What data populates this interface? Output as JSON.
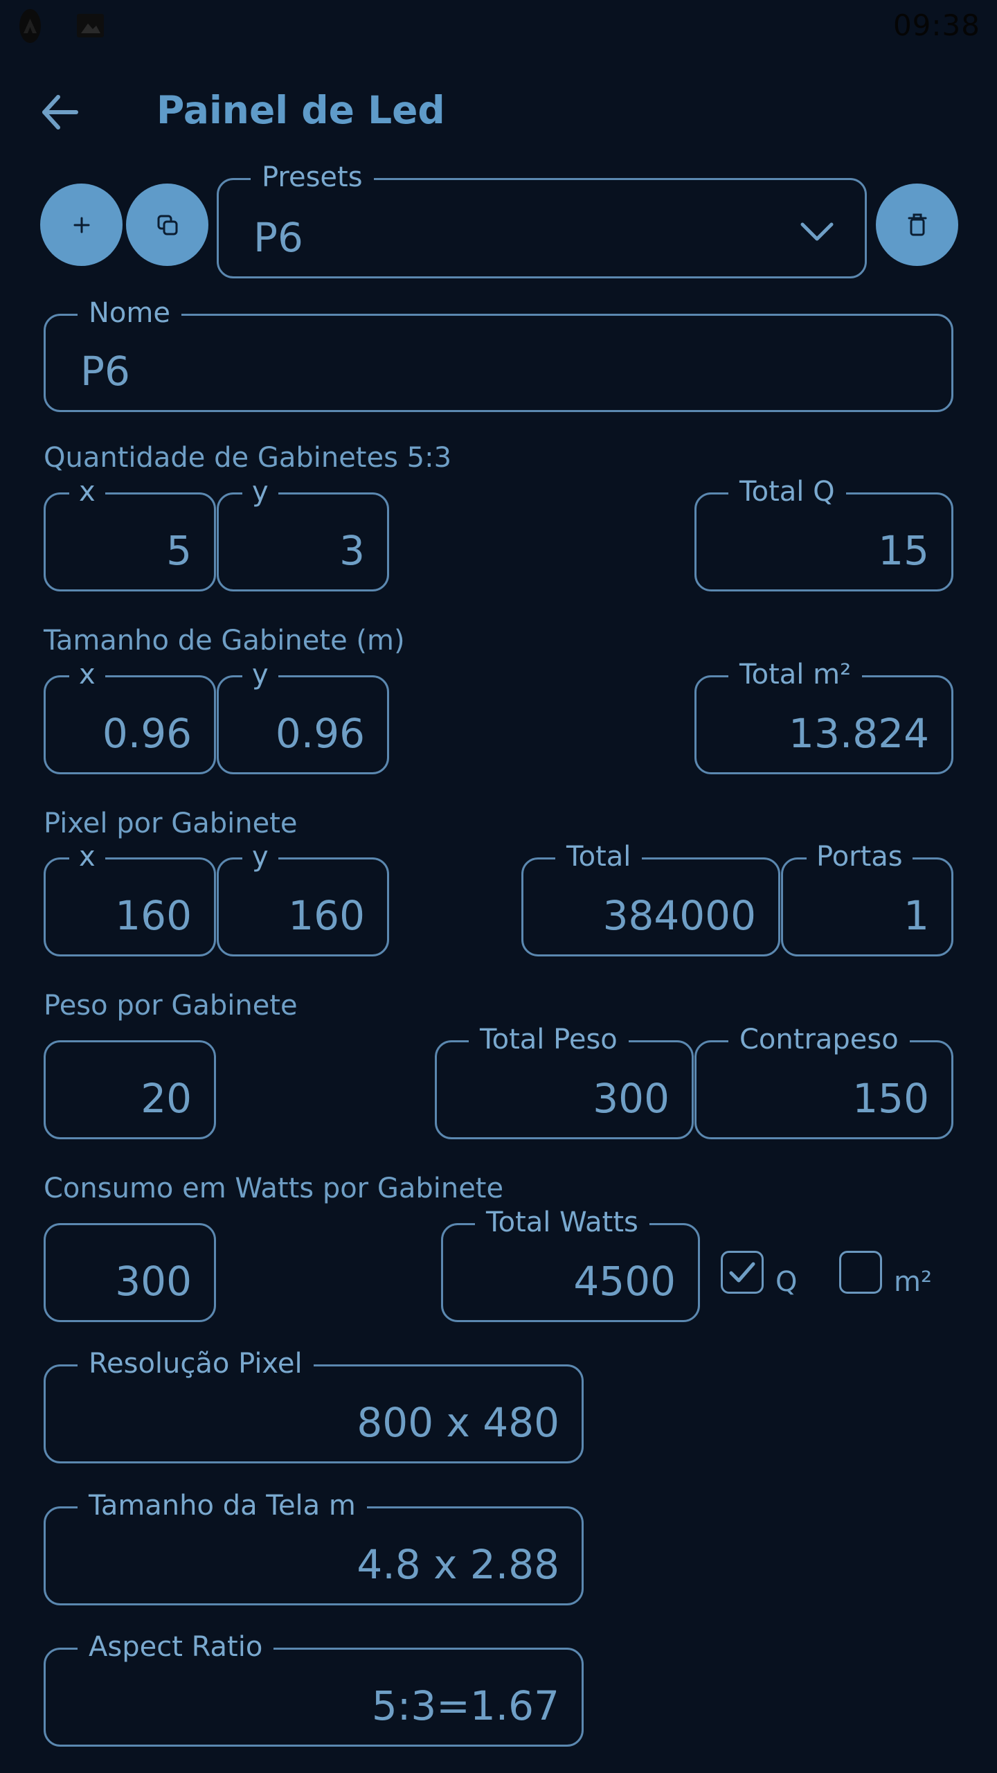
{
  "status_bar": {
    "time": "09:38",
    "icons": [
      "app-notification-icon",
      "image-notification-icon"
    ]
  },
  "header": {
    "title": "Painel de Led",
    "back_icon": "arrow-left-icon"
  },
  "toolbar": {
    "add_icon": "plus-icon",
    "copy_icon": "copy-icon",
    "delete_icon": "trash-icon"
  },
  "presets": {
    "label": "Presets",
    "value": "P6"
  },
  "nome": {
    "label": "Nome",
    "value": "P6"
  },
  "quantidade": {
    "section_label": "Quantidade de Gabinetes 5:3",
    "x_label": "x",
    "x_value": "5",
    "y_label": "y",
    "y_value": "3",
    "total_label": "Total Q",
    "total_value": "15"
  },
  "tamanho": {
    "section_label": "Tamanho de Gabinete (m)",
    "x_label": "x",
    "x_value": "0.96",
    "y_label": "y",
    "y_value": "0.96",
    "total_label": "Total m²",
    "total_value": "13.824"
  },
  "pixel": {
    "section_label": "Pixel por Gabinete",
    "x_label": "x",
    "x_value": "160",
    "y_label": "y",
    "y_value": "160",
    "total_label": "Total",
    "total_value": "384000",
    "portas_label": "Portas",
    "portas_value": "1"
  },
  "peso": {
    "section_label": "Peso por Gabinete",
    "value": "20",
    "total_label": "Total Peso",
    "total_value": "300",
    "contrapeso_label": "Contrapeso",
    "contrapeso_value": "150"
  },
  "consumo": {
    "section_label": "Consumo em Watts por Gabinete",
    "value": "300",
    "total_label": "Total Watts",
    "total_value": "4500",
    "checkbox_q_label": "Q",
    "checkbox_q_checked": true,
    "checkbox_m2_label": "m²",
    "checkbox_m2_checked": false
  },
  "resolucao": {
    "label": "Resolução Pixel",
    "value": "800 x 480"
  },
  "tamanho_tela": {
    "label": "Tamanho da Tela m",
    "value": "4.8 x 2.88"
  },
  "aspect_ratio": {
    "label": "Aspect Ratio",
    "value": "5:3=1.67"
  },
  "colors": {
    "background": "#08111f",
    "accent": "#5f9bc9",
    "border": "#5b88b0",
    "text": "#6f9fc6"
  }
}
